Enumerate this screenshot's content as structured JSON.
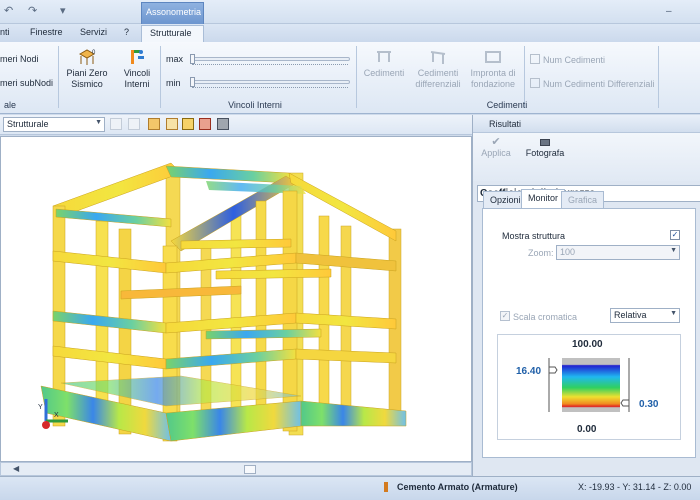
{
  "titlebar": {
    "context_tab": "Assonometria",
    "qa_undo": "↶",
    "qa_redo": "↷",
    "qa_more": "▾",
    "win_min": "–",
    "help": "?"
  },
  "tabs": [
    {
      "label": "nti"
    },
    {
      "label": "Finestre"
    },
    {
      "label": "Servizi"
    },
    {
      "label": "?"
    },
    {
      "label": "Strutturale"
    }
  ],
  "ribbon": {
    "group1": {
      "items": [
        "meri Nodi",
        "meri subNodi"
      ],
      "label": "ale"
    },
    "piani_zero": {
      "line1": "Piani Zero",
      "line2": "Sismico"
    },
    "vincoli": {
      "line1": "Vincoli",
      "line2": "Interni"
    },
    "slider_max": "max",
    "slider_min": "min",
    "group_vincoli_label": "Vincoli Interni",
    "cedimenti": {
      "label": "Cedimenti"
    },
    "cedimenti_diff": {
      "line1": "Cedimenti",
      "line2": "differenziali"
    },
    "impronta": {
      "line1": "Impronta di",
      "line2": "fondazione"
    },
    "num_cedimenti": "Num Cedimenti",
    "num_cedimenti_diff": "Num Cedimenti Differenziali",
    "group_cedimenti_label": "Cedimenti"
  },
  "toolbar": {
    "view_select": "Strutturale"
  },
  "panel": {
    "title": "Risultati",
    "applica": "Applica",
    "fotografa": "Fotografa",
    "section_title": "Coefficienti di Sicurezza",
    "tabs": [
      "Opzioni",
      "Monitor",
      "Grafica"
    ],
    "mostra_struttura": "Mostra struttura",
    "zoom_label": "Zoom:",
    "zoom_value": "100",
    "scala_cromatica": "Scala cromatica",
    "scala_mode": "Relativa",
    "legend_max": "100.00",
    "legend_min": "0.00",
    "legend_upper": "16.40",
    "legend_lower": "0.30",
    "check_mark": "✓"
  },
  "statusbar": {
    "material": "Cemento Armato (Armature)",
    "coords": "X: -19.93 - Y: 31.14 - Z: 0.00"
  },
  "colors": {
    "accent": "#6d96cf",
    "legend_value": "#1f5fa8"
  }
}
